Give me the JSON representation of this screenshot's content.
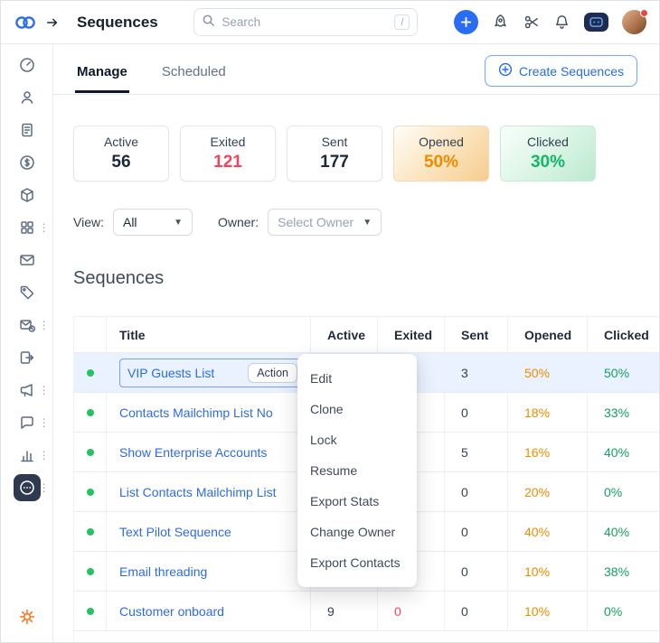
{
  "header": {
    "title": "Sequences",
    "search": {
      "placeholder": "Search",
      "shortcut": "/"
    }
  },
  "sidebar": {
    "icons": [
      "dashboard",
      "contacts",
      "notes",
      "payments",
      "products",
      "apps",
      "email",
      "tags",
      "campaigns",
      "journeys",
      "broadcast",
      "chat",
      "reports",
      "sequences",
      "settings"
    ],
    "active_item": "sequences"
  },
  "tabs": {
    "items": [
      {
        "label": "Manage",
        "active": true
      },
      {
        "label": "Scheduled",
        "active": false
      }
    ],
    "create_button_label": "Create Sequences"
  },
  "stats": [
    {
      "label": "Active",
      "value": "56"
    },
    {
      "label": "Exited",
      "value": "121"
    },
    {
      "label": "Sent",
      "value": "177"
    },
    {
      "label": "Opened",
      "value": "50%"
    },
    {
      "label": "Clicked",
      "value": "30%"
    }
  ],
  "filters": {
    "view_label": "View:",
    "view_value": "All",
    "owner_label": "Owner:",
    "owner_placeholder": "Select Owner"
  },
  "section_title": "Sequences",
  "table": {
    "columns": [
      "Title",
      "Active",
      "Exited",
      "Sent",
      "Opened",
      "Clicked"
    ],
    "rows": [
      {
        "title": "VIP Guests List",
        "action_label": "Action",
        "active": "",
        "exited": "",
        "sent": "3",
        "opened": "50%",
        "clicked": "50%",
        "selected": true
      },
      {
        "title": "Contacts Mailchimp List No",
        "active": "",
        "exited": "",
        "sent": "0",
        "opened": "18%",
        "clicked": "33%"
      },
      {
        "title": "Show Enterprise Accounts",
        "active": "",
        "exited": "",
        "sent": "5",
        "opened": "16%",
        "clicked": "40%"
      },
      {
        "title": "List Contacts Mailchimp List",
        "active": "",
        "exited": "",
        "sent": "0",
        "opened": "20%",
        "clicked": "0%"
      },
      {
        "title": "Text Pilot Sequence",
        "active": "",
        "exited": "",
        "sent": "0",
        "opened": "40%",
        "clicked": "40%"
      },
      {
        "title": "Email threading",
        "active": "",
        "exited": "",
        "sent": "0",
        "opened": "10%",
        "clicked": "38%"
      },
      {
        "title": "Customer onboard",
        "active": "9",
        "exited": "0",
        "sent": "0",
        "opened": "10%",
        "clicked": "0%"
      }
    ]
  },
  "context_menu": {
    "items": [
      "Edit",
      "Clone",
      "Lock",
      "Resume",
      "Export Stats",
      "Change Owner",
      "Export Contacts"
    ]
  },
  "colors": {
    "accent_blue": "#2a6df4",
    "link_blue": "#2e6be5",
    "orange": "#ee8b00",
    "green": "#12b76a",
    "red": "#f2455a",
    "status_dot_green": "#22c55e"
  }
}
